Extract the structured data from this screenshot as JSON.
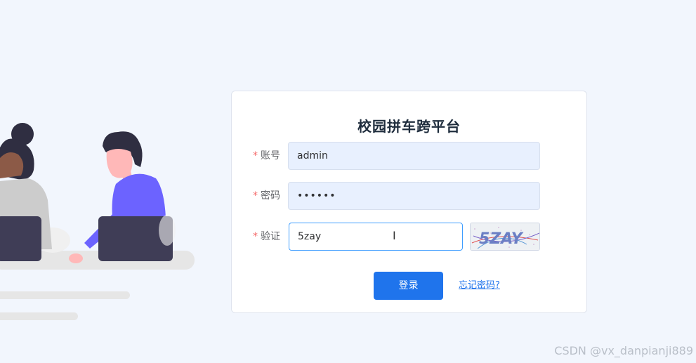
{
  "app": {
    "title": "校园拼车跨平台"
  },
  "form": {
    "account": {
      "required_mark": "*",
      "label": "账号",
      "value": "admin"
    },
    "password": {
      "required_mark": "*",
      "label": "密码",
      "value": "••••••"
    },
    "captcha": {
      "required_mark": "*",
      "label": "验证",
      "value": "5zay",
      "image_text": "5ZAY"
    }
  },
  "actions": {
    "login_label": "登录",
    "forgot_label": "忘记密码?"
  },
  "watermark": "CSDN @vx_danpianji889",
  "colors": {
    "background": "#f2f6fd",
    "accent": "#1f74ec",
    "autofill": "#e8f0fe",
    "required": "#f56c6c",
    "illustration_purple": "#6c63ff",
    "illustration_dark": "#33323f"
  },
  "icons": {
    "cursor": "text-ibeam-cursor-icon"
  }
}
